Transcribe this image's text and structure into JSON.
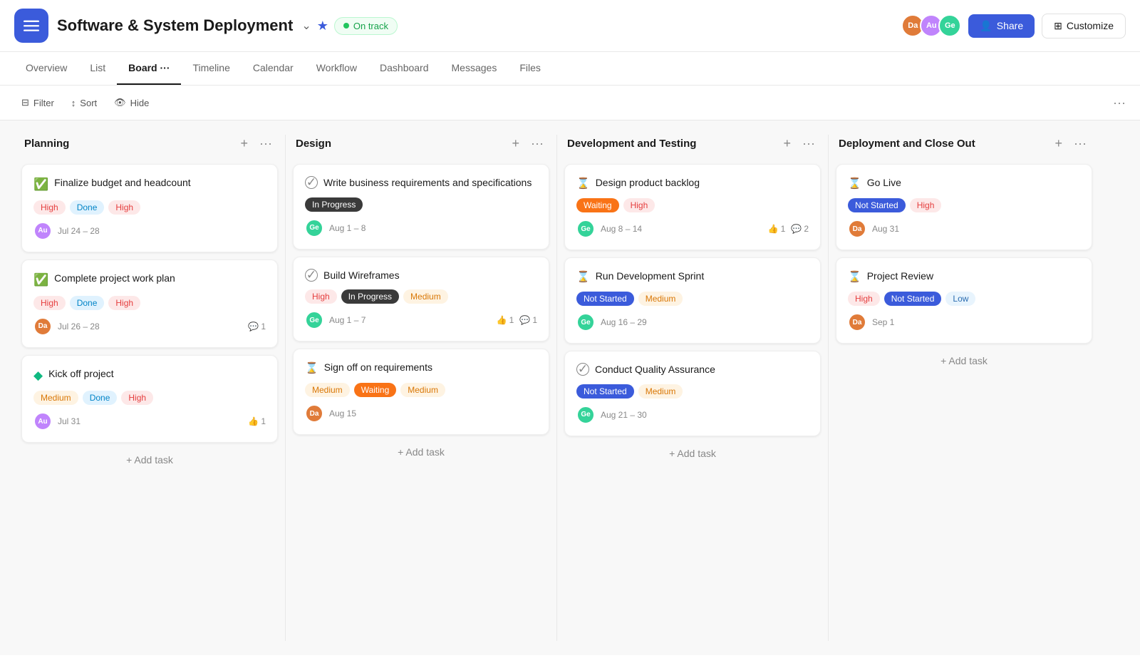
{
  "header": {
    "project_title": "Software & System Deployment",
    "status_label": "On track",
    "share_label": "Share",
    "customize_label": "Customize",
    "avatars": [
      {
        "initials": "Da",
        "color": "#e07b39"
      },
      {
        "initials": "Au",
        "color": "#c084fc"
      },
      {
        "initials": "Ge",
        "color": "#34d399"
      }
    ]
  },
  "nav": {
    "tabs": [
      "Overview",
      "List",
      "Board",
      "Timeline",
      "Calendar",
      "Workflow",
      "Dashboard",
      "Messages",
      "Files"
    ],
    "active": "Board"
  },
  "toolbar": {
    "filter_label": "Filter",
    "sort_label": "Sort",
    "hide_label": "Hide"
  },
  "columns": [
    {
      "id": "planning",
      "title": "Planning",
      "cards": [
        {
          "id": "p1",
          "icon": "check-circle-green",
          "title": "Finalize budget and headcount",
          "tags": [
            {
              "label": "High",
              "type": "high"
            },
            {
              "label": "Done",
              "type": "done"
            },
            {
              "label": "High",
              "type": "high"
            }
          ],
          "avatar": {
            "initials": "Au",
            "color": "#c084fc"
          },
          "date": "Jul 24 – 28",
          "likes": null,
          "comments": null
        },
        {
          "id": "p2",
          "icon": "check-circle-green",
          "title": "Complete project work plan",
          "tags": [
            {
              "label": "High",
              "type": "high"
            },
            {
              "label": "Done",
              "type": "done"
            },
            {
              "label": "High",
              "type": "high"
            }
          ],
          "avatar": {
            "initials": "Da",
            "color": "#e07b39"
          },
          "date": "Jul 26 – 28",
          "likes": null,
          "comments": "1"
        },
        {
          "id": "p3",
          "icon": "check-diamond-green",
          "title": "Kick off project",
          "tags": [
            {
              "label": "Medium",
              "type": "medium"
            },
            {
              "label": "Done",
              "type": "done"
            },
            {
              "label": "High",
              "type": "high"
            }
          ],
          "avatar": {
            "initials": "Au",
            "color": "#c084fc"
          },
          "date": "Jul 31",
          "likes": "1",
          "comments": null
        }
      ],
      "add_task_label": "+ Add task"
    },
    {
      "id": "design",
      "title": "Design",
      "cards": [
        {
          "id": "d1",
          "icon": "circle-check",
          "title": "Write business requirements and specifications",
          "tags": [
            {
              "label": "In Progress",
              "type": "in-progress"
            }
          ],
          "avatar": {
            "initials": "Ge",
            "color": "#34d399"
          },
          "date": "Aug 1 – 8",
          "likes": null,
          "comments": null
        },
        {
          "id": "d2",
          "icon": "circle-check",
          "title": "Build Wireframes",
          "tags": [
            {
              "label": "High",
              "type": "high"
            },
            {
              "label": "In Progress",
              "type": "in-progress"
            },
            {
              "label": "Medium",
              "type": "medium"
            }
          ],
          "avatar": {
            "initials": "Ge",
            "color": "#34d399"
          },
          "date": "Aug 1 – 7",
          "likes": "1",
          "comments": "1"
        },
        {
          "id": "d3",
          "icon": "hourglass",
          "title": "Sign off on requirements",
          "tags": [
            {
              "label": "Medium",
              "type": "medium"
            },
            {
              "label": "Waiting",
              "type": "waiting"
            },
            {
              "label": "Medium",
              "type": "medium"
            }
          ],
          "avatar": {
            "initials": "Da",
            "color": "#e07b39"
          },
          "date": "Aug 15",
          "likes": null,
          "comments": null
        }
      ],
      "add_task_label": "+ Add task"
    },
    {
      "id": "dev-testing",
      "title": "Development and Testing",
      "cards": [
        {
          "id": "dt1",
          "icon": "hourglass",
          "title": "Design product backlog",
          "tags": [
            {
              "label": "Waiting",
              "type": "waiting"
            },
            {
              "label": "High",
              "type": "high"
            }
          ],
          "avatar": {
            "initials": "Ge",
            "color": "#34d399"
          },
          "date": "Aug 8 – 14",
          "likes": "1",
          "comments": "2"
        },
        {
          "id": "dt2",
          "icon": "hourglass",
          "title": "Run Development Sprint",
          "tags": [
            {
              "label": "Not Started",
              "type": "not-started"
            },
            {
              "label": "Medium",
              "type": "medium"
            }
          ],
          "avatar": {
            "initials": "Ge",
            "color": "#34d399"
          },
          "date": "Aug 16 – 29",
          "likes": null,
          "comments": null
        },
        {
          "id": "dt3",
          "icon": "circle-check",
          "title": "Conduct Quality Assurance",
          "tags": [
            {
              "label": "Not Started",
              "type": "not-started"
            },
            {
              "label": "Medium",
              "type": "medium"
            }
          ],
          "avatar": {
            "initials": "Ge",
            "color": "#34d399"
          },
          "date": "Aug 21 – 30",
          "likes": null,
          "comments": null
        }
      ],
      "add_task_label": "+ Add task"
    },
    {
      "id": "deployment",
      "title": "Deployment and Close Out",
      "cards": [
        {
          "id": "dep1",
          "icon": "hourglass",
          "title": "Go Live",
          "tags": [
            {
              "label": "Not Started",
              "type": "not-started"
            },
            {
              "label": "High",
              "type": "high"
            }
          ],
          "avatar": {
            "initials": "Da",
            "color": "#e07b39"
          },
          "date": "Aug 31",
          "likes": null,
          "comments": null
        },
        {
          "id": "dep2",
          "icon": "hourglass",
          "title": "Project Review",
          "tags": [
            {
              "label": "High",
              "type": "high"
            },
            {
              "label": "Not Started",
              "type": "not-started"
            },
            {
              "label": "Low",
              "type": "low"
            }
          ],
          "avatar": {
            "initials": "Da",
            "color": "#e07b39"
          },
          "date": "Sep 1",
          "likes": null,
          "comments": null
        }
      ],
      "add_task_label": "+ Add task"
    }
  ]
}
